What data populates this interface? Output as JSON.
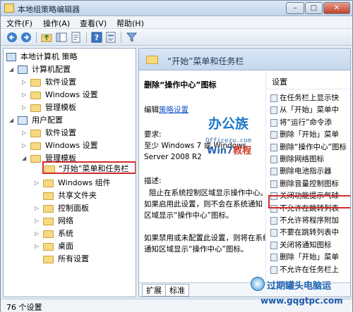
{
  "window": {
    "title": "本地组策略编辑器",
    "minimize_label": "–",
    "maximize_label": "□",
    "close_label": "✕"
  },
  "menu": [
    "文件(F)",
    "操作(A)",
    "查看(V)",
    "帮助(H)"
  ],
  "toolbar": {
    "icons": [
      "back-arrow-icon",
      "forward-arrow-icon",
      "up-folder-icon",
      "show-hide-tree-icon",
      "export-list-icon",
      "help-icon",
      "properties-icon",
      "filter-icon"
    ]
  },
  "tree": {
    "root": "本地计算机 策略",
    "computer_config": "计算机配置",
    "cc_software": "软件设置",
    "cc_windows": "Windows 设置",
    "cc_admin": "管理模板",
    "user_config": "用户配置",
    "uc_software": "软件设置",
    "uc_windows": "Windows 设置",
    "uc_admin": "管理模板",
    "start_menu": "“开始”菜单和任务栏",
    "windows_components": "Windows 组件",
    "shared_folders": "共享文件夹",
    "control_panel": "控制面板",
    "network": "网络",
    "system": "系统",
    "desktop": "桌面",
    "all_settings": "所有设置"
  },
  "detail": {
    "header": "“开始”菜单和任务栏",
    "policy_title": "删除“操作中心”图标",
    "edit_prefix": "编辑",
    "edit_link": "策略设置",
    "requirements_label": "要求:",
    "requirements_line1": "至少 Windows 7 或 Windows",
    "requirements_line2": "Server 2008 R2",
    "description_label": "描述:",
    "desc_line1": "阻止在系统控制区域显示操作中心。",
    "desc_line2": "如果启用此设置，则不会在系统通知",
    "desc_line3": "区域显示“操作中心”图标。",
    "desc_line4": "如果禁用或未配置此设置，则将在系统",
    "desc_line5": "通知区域显示“操作中心”图标。"
  },
  "watermark": {
    "brand": "办公族",
    "url": "Officezu.com",
    "win_prefix": "Win7",
    "win_suffix": "教程"
  },
  "list": {
    "header": "设置",
    "items": [
      "在任务栏上显示快",
      "从「开始」菜单中",
      "将“运行”命令添",
      "删除「开始」菜单",
      "删除“操作中心”图标",
      "删除网络图标",
      "删除电池指示器",
      "删除音量控制图标",
      "关闭功能提示气球",
      "不允许在跳转列表",
      "不允许将程序附加",
      "不要在跳转列表中",
      "关闭将通知图标",
      "删除「开始」菜单",
      "不允许在任务栏上"
    ]
  },
  "tabs": [
    "扩展",
    "标准"
  ],
  "status": "76 个设置",
  "footer_logo": {
    "brand": "过期罐头电脑运",
    "url": "www.gqgtpc.com"
  }
}
